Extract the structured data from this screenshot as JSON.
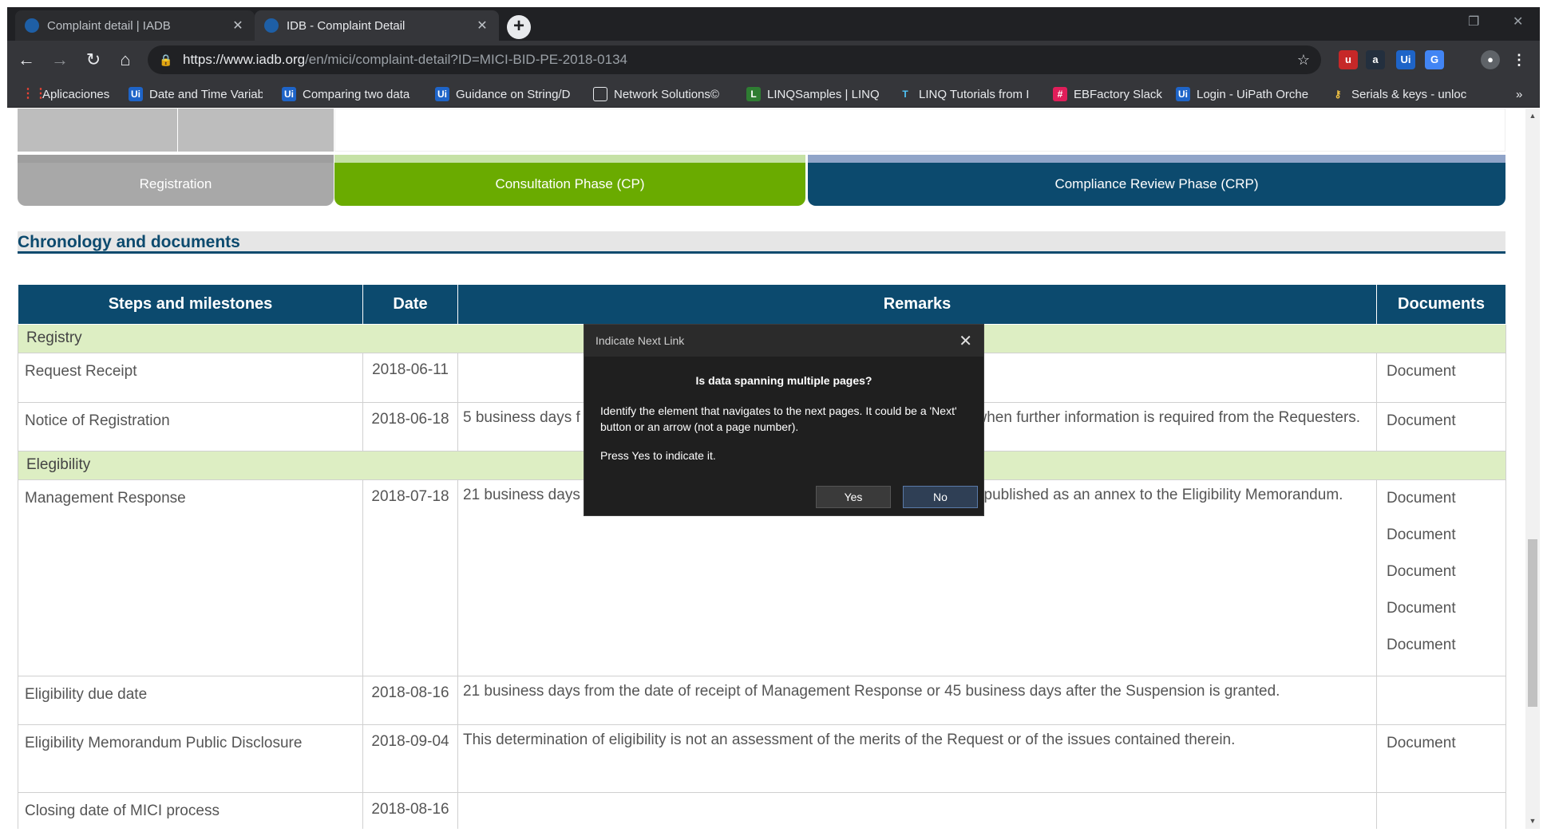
{
  "browser": {
    "tabs": [
      {
        "title": "Complaint detail | IADB",
        "close": "✕"
      },
      {
        "title": "IDB - Complaint Detail",
        "close": "✕"
      }
    ],
    "new_tab": "+",
    "url_host": "https://www.iadb.org",
    "url_rest": "/en/mici/complaint-detail?ID=MICI-BID-PE-2018-0134",
    "bookmarks": [
      {
        "label": "Aplicaciones",
        "icon": "apps-grid-icon"
      },
      {
        "label": "Date and Time Variab",
        "icon": "uipath-icon"
      },
      {
        "label": "Comparing two data",
        "icon": "uipath-icon"
      },
      {
        "label": "Guidance on String/D",
        "icon": "uipath-icon"
      },
      {
        "label": "Network Solutions©",
        "icon": "page-icon"
      },
      {
        "label": "LINQSamples | LINQ",
        "icon": "linq-icon"
      },
      {
        "label": "LINQ Tutorials from I",
        "icon": "tutorial-icon"
      },
      {
        "label": "EBFactory Slack",
        "icon": "slack-icon"
      },
      {
        "label": "Login - UiPath Orche",
        "icon": "uipath-icon"
      },
      {
        "label": "Serials & keys - unloc",
        "icon": "key-icon"
      }
    ],
    "more_bookmarks": "»"
  },
  "phases": {
    "registration": "Registration",
    "consultation": "Consultation Phase (CP)",
    "compliance": "Compliance Review Phase (CRP)"
  },
  "section_title": "Chronology and documents",
  "table": {
    "headers": [
      "Steps and milestones",
      "Date",
      "Remarks",
      "Documents"
    ],
    "groups": {
      "registry": "Registry",
      "eligibility": "Elegibility"
    },
    "rows": [
      {
        "step": "Request Receipt",
        "date": "2018-06-11",
        "remarks": "",
        "docs": [
          "Document"
        ]
      },
      {
        "step": "Notice of Registration",
        "date": "2018-06-18",
        "remarks_left": "5 business days f",
        "remarks_right": "when further information is required from the Requesters.",
        "docs": [
          "Document"
        ]
      },
      {
        "step": "Management Response",
        "date": "2018-07-18",
        "remarks_left": "21 business days",
        "remarks_right": "published as an annex to the Eligibility Memorandum.",
        "docs": [
          "Document",
          "Document",
          "Document",
          "Document",
          "Document"
        ]
      },
      {
        "step": "Eligibility due date",
        "date": "2018-08-16",
        "remarks": "21 business days from the date of receipt of Management Response or 45 business days after the Suspension is granted.",
        "docs": []
      },
      {
        "step": "Eligibility Memorandum Public Disclosure",
        "date": "2018-09-04",
        "remarks": "This determination of eligibility is not an assessment of the merits of the Request or of the issues contained therein.",
        "docs": [
          "Document"
        ]
      },
      {
        "step": "Closing date of MICI process",
        "date": "2018-08-16",
        "remarks": "",
        "docs": []
      }
    ]
  },
  "dialog": {
    "title": "Indicate Next Link",
    "close": "✕",
    "question": "Is data spanning multiple pages?",
    "body": "Identify the element that navigates to the next pages. It could be a 'Next' button or an arrow (not a page number).",
    "hint": "Press Yes to indicate it.",
    "yes": "Yes",
    "no": "No"
  },
  "colors": {
    "header_blue": "#0c4a6e",
    "consultation_green": "#6aab00",
    "registration_gray": "#a8a8a8",
    "group_row": "#ddeec3"
  }
}
